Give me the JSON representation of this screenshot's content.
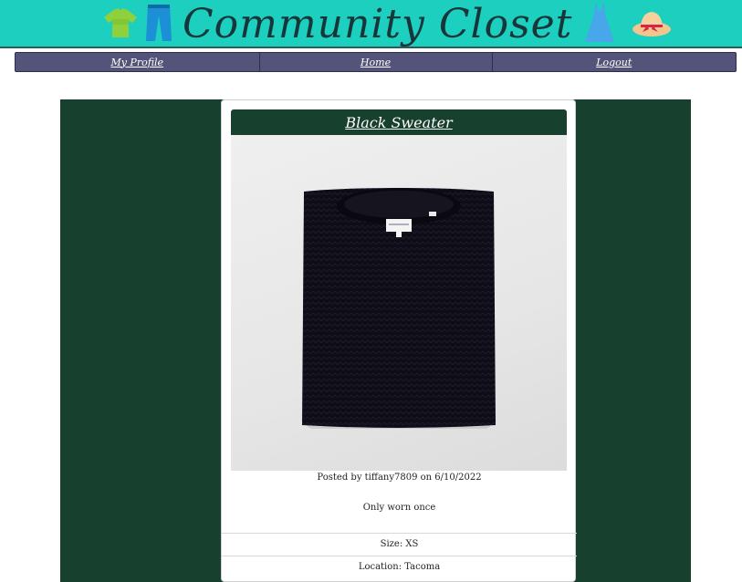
{
  "header": {
    "title": "Community Closet",
    "icons": [
      "tshirt-icon",
      "jeans-icon",
      "dress-icon",
      "sunhat-icon"
    ]
  },
  "nav": {
    "items": [
      {
        "label": "My Profile"
      },
      {
        "label": "Home"
      },
      {
        "label": "Logout"
      }
    ]
  },
  "listing": {
    "title": "Black Sweater",
    "posted_by": "Posted by tiffany7809 on 6/10/2022",
    "description": "Only worn once",
    "size": "Size: XS",
    "location": "Location: Tacoma"
  },
  "colors": {
    "header_bg": "#1ccfbf",
    "nav_bg": "#54547a",
    "page_bg": "#18402e",
    "card_title_bg": "#18402e"
  }
}
